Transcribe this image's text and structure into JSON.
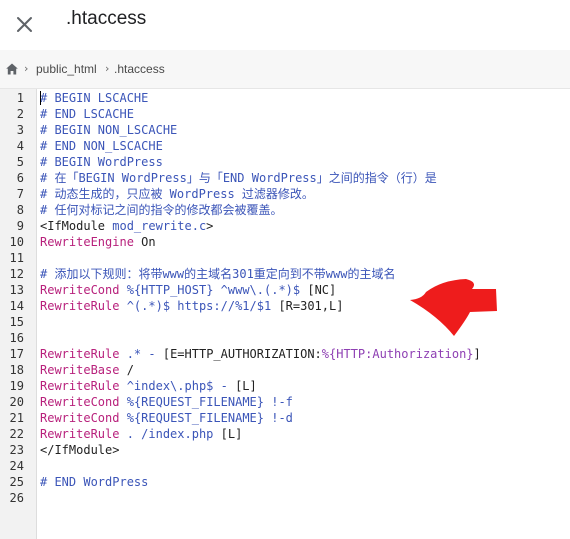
{
  "window": {
    "title": ".htaccess",
    "close_icon": "close-icon"
  },
  "breadcrumb": {
    "home_icon": "home-icon",
    "items": [
      "public_html",
      ".htaccess"
    ]
  },
  "colors": {
    "comment": "#3b55b8",
    "directive": "#b8217c",
    "variable": "#8e3fb3",
    "default": "#222222",
    "arrow": "#ee1c1c"
  },
  "editor": {
    "lines": [
      [
        [
          "# BEGIN LSCACHE",
          "comment"
        ]
      ],
      [
        [
          "# END LSCACHE",
          "comment"
        ]
      ],
      [
        [
          "# BEGIN NON_LSCACHE",
          "comment"
        ]
      ],
      [
        [
          "# END NON_LSCACHE",
          "comment"
        ]
      ],
      [
        [
          "# BEGIN WordPress",
          "comment"
        ]
      ],
      [
        [
          "# 在「BEGIN WordPress」与「END WordPress」之间的指令（行）是",
          "comment"
        ]
      ],
      [
        [
          "# 动态生成的，只应被 WordPress 过滤器修改。",
          "comment"
        ]
      ],
      [
        [
          "# 任何对标记之间的指令的修改都会被覆盖。",
          "comment"
        ]
      ],
      [
        [
          "<IfModule ",
          "default"
        ],
        [
          "mod_rewrite.c",
          "comment"
        ],
        [
          ">",
          "default"
        ]
      ],
      [
        [
          "RewriteEngine",
          "directive"
        ],
        [
          " On",
          "default"
        ]
      ],
      [],
      [
        [
          "# 添加以下规则：将带www的主域名301重定向到不带www的主域名",
          "comment"
        ]
      ],
      [
        [
          "RewriteCond",
          "directive"
        ],
        [
          " ",
          "default"
        ],
        [
          "%{HTTP_HOST}",
          "comment"
        ],
        [
          " ^www\\.(.*)$ ",
          "comment"
        ],
        [
          "[NC]",
          "default"
        ]
      ],
      [
        [
          "RewriteRule",
          "directive"
        ],
        [
          " ^(.*)$ https://%1/$1 ",
          "comment"
        ],
        [
          "[R=301,L]",
          "default"
        ]
      ],
      [],
      [],
      [
        [
          "RewriteRule",
          "directive"
        ],
        [
          " .* - ",
          "comment"
        ],
        [
          "[E=HTTP_AUTHORIZATION:",
          "default"
        ],
        [
          "%{HTTP:Authorization}",
          "variable"
        ],
        [
          "]",
          "default"
        ]
      ],
      [
        [
          "RewriteBase",
          "directive"
        ],
        [
          " /",
          "default"
        ]
      ],
      [
        [
          "RewriteRule",
          "directive"
        ],
        [
          " ^index\\.php$ - ",
          "comment"
        ],
        [
          "[L]",
          "default"
        ]
      ],
      [
        [
          "RewriteCond",
          "directive"
        ],
        [
          " ",
          "default"
        ],
        [
          "%{REQUEST_FILENAME}",
          "comment"
        ],
        [
          " !-f",
          "comment"
        ]
      ],
      [
        [
          "RewriteCond",
          "directive"
        ],
        [
          " ",
          "default"
        ],
        [
          "%{REQUEST_FILENAME}",
          "comment"
        ],
        [
          " !-d",
          "comment"
        ]
      ],
      [
        [
          "RewriteRule",
          "directive"
        ],
        [
          " . /index.php ",
          "comment"
        ],
        [
          "[L]",
          "default"
        ]
      ],
      [
        [
          "</IfModule>",
          "default"
        ]
      ],
      [],
      [
        [
          "# END WordPress",
          "comment"
        ]
      ],
      []
    ]
  },
  "annotation": {
    "arrow_icon": "red-arrow-icon"
  }
}
